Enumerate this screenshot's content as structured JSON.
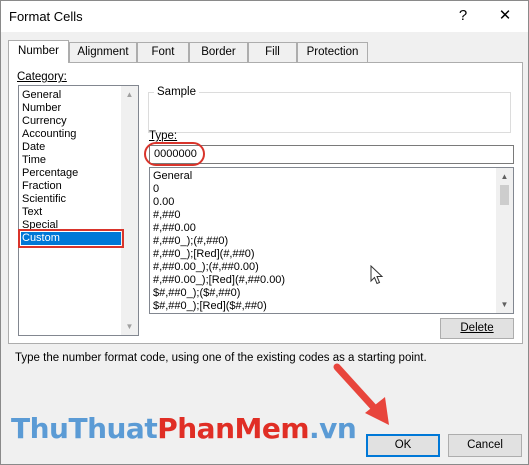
{
  "window": {
    "title": "Format Cells",
    "help_label": "?",
    "close_label": "✕"
  },
  "tabs": [
    {
      "label": "Number",
      "active": true
    },
    {
      "label": "Alignment"
    },
    {
      "label": "Font"
    },
    {
      "label": "Border"
    },
    {
      "label": "Fill"
    },
    {
      "label": "Protection"
    }
  ],
  "category": {
    "label": "Category:",
    "items": [
      "General",
      "Number",
      "Currency",
      "Accounting",
      "Date",
      "Time",
      "Percentage",
      "Fraction",
      "Scientific",
      "Text",
      "Special",
      "Custom"
    ],
    "selected": "Custom"
  },
  "sample": {
    "label": "Sample",
    "value": ""
  },
  "type": {
    "label": "Type:",
    "value": "0000000",
    "formats": [
      "General",
      "0",
      "0.00",
      "#,##0",
      "#,##0.00",
      "#,##0_);(#,##0)",
      "#,##0_);[Red](#,##0)",
      "#,##0.00_);(#,##0.00)",
      "#,##0.00_);[Red](#,##0.00)",
      "$#,##0_);($#,##0)",
      "$#,##0_);[Red]($#,##0)"
    ]
  },
  "buttons": {
    "delete": "Delete",
    "ok": "OK",
    "cancel": "Cancel"
  },
  "hint": "Type the number format code, using one of the existing codes as a starting point.",
  "watermark": {
    "part1": "ThuThuat",
    "part2": "PhanMem",
    "part3": ".vn"
  },
  "colors": {
    "accent": "#0078d7",
    "annotation": "#d9342b"
  }
}
